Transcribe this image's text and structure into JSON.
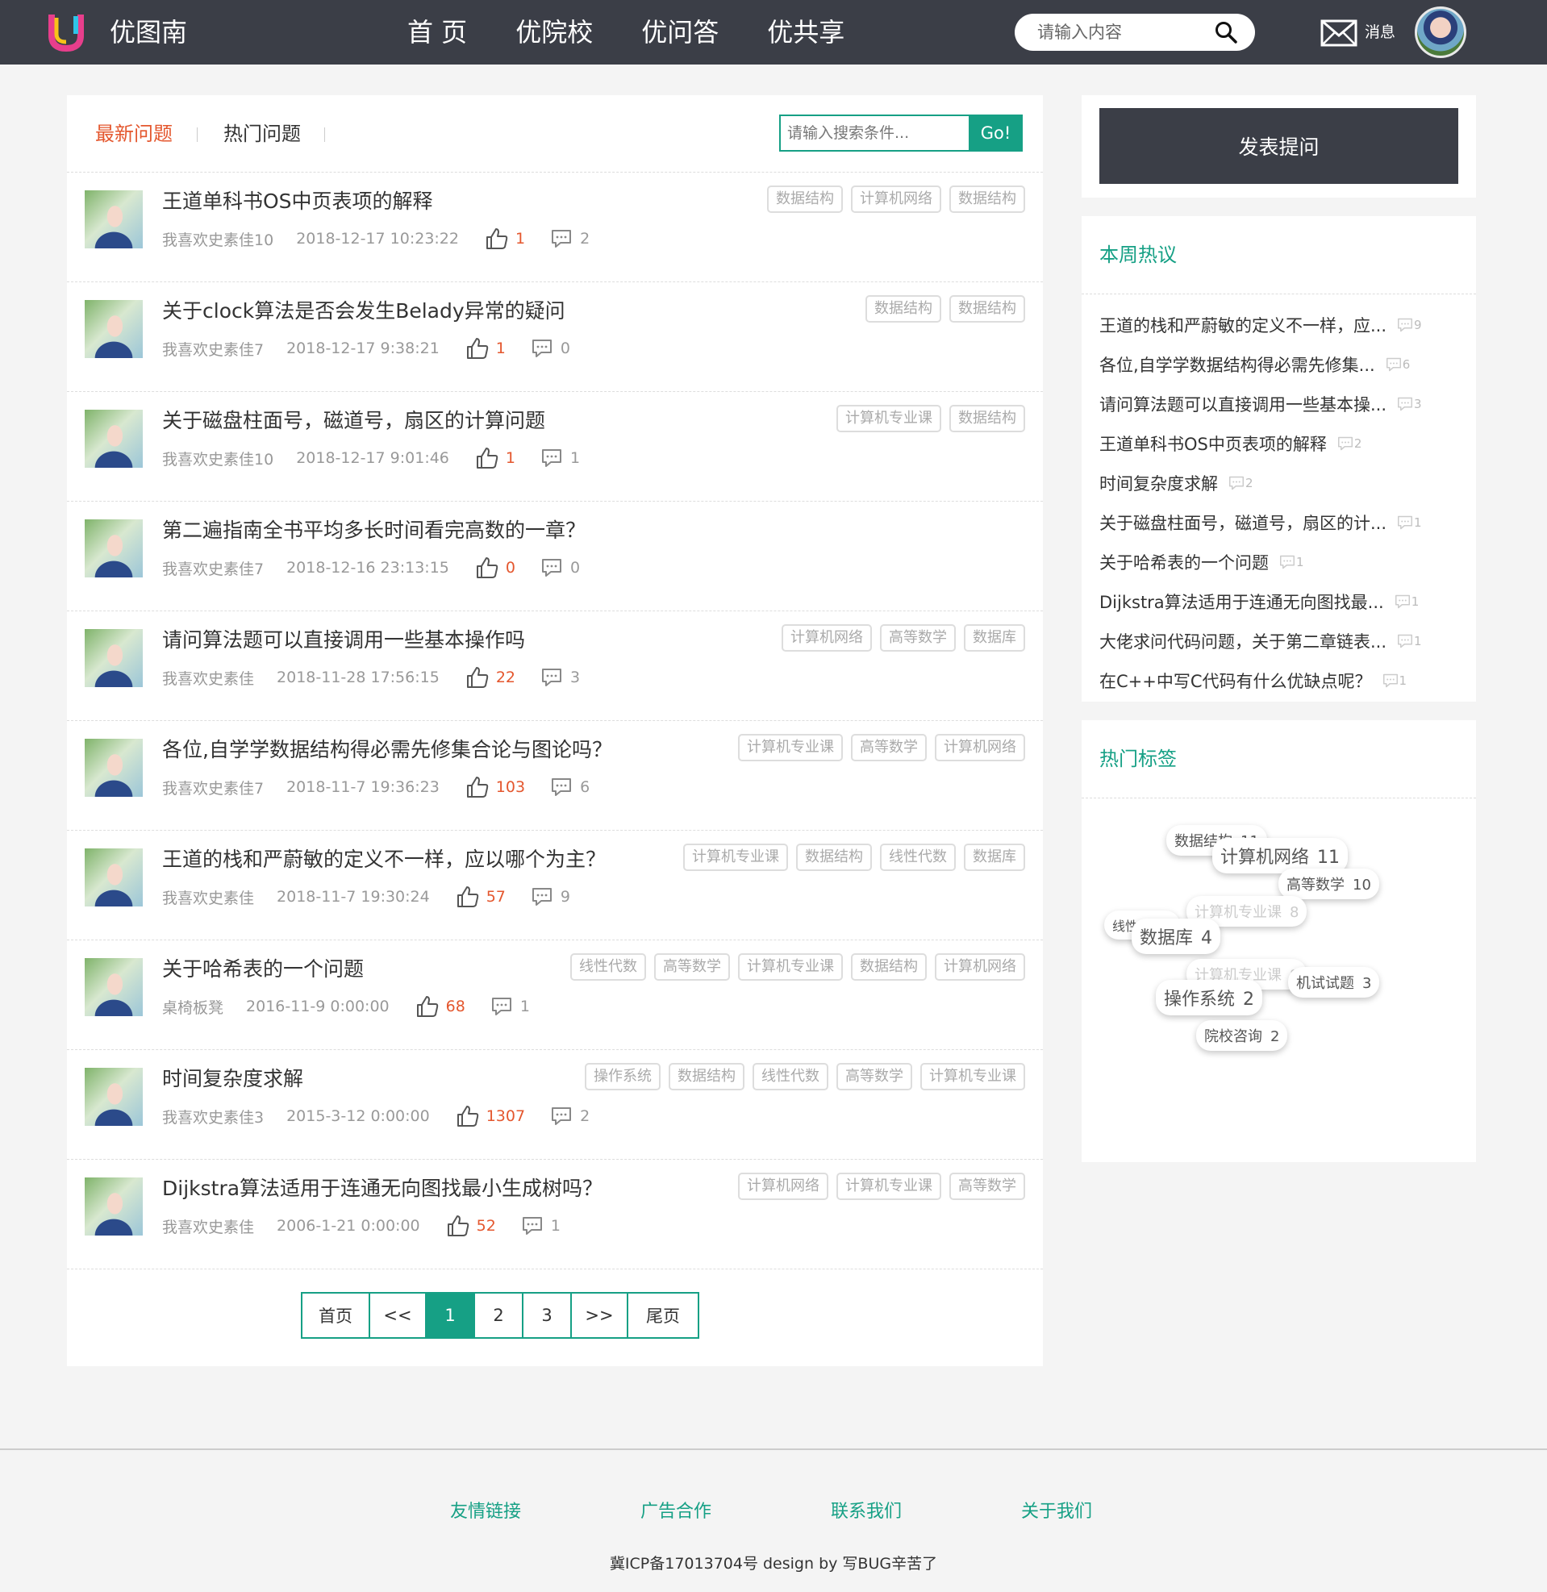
{
  "header": {
    "logo_text": "优图南",
    "nav": [
      "首 页",
      "优院校",
      "优问答",
      "优共享"
    ],
    "search_placeholder": "请输入内容",
    "message_label": "消息"
  },
  "tabs": {
    "latest": "最新问题",
    "hot": "热门问题"
  },
  "filter": {
    "placeholder": "请输入搜索条件...",
    "button": "Go!"
  },
  "questions": [
    {
      "title": "王道单科书OS中页表项的解释",
      "author": "我喜欢史素佳10",
      "date": "2018-12-17 10:23:22",
      "likes": "1",
      "comments": "2",
      "tags": [
        "数据结构",
        "计算机网络",
        "数据结构"
      ]
    },
    {
      "title": "关于clock算法是否会发生Belady异常的疑问",
      "author": "我喜欢史素佳7",
      "date": "2018-12-17 9:38:21",
      "likes": "1",
      "comments": "0",
      "tags": [
        "数据结构",
        "数据结构"
      ]
    },
    {
      "title": "关于磁盘柱面号，磁道号，扇区的计算问题",
      "author": "我喜欢史素佳10",
      "date": "2018-12-17 9:01:46",
      "likes": "1",
      "comments": "1",
      "tags": [
        "计算机专业课",
        "数据结构"
      ]
    },
    {
      "title": "第二遍指南全书平均多长时间看完高数的一章？",
      "author": "我喜欢史素佳7",
      "date": "2018-12-16 23:13:15",
      "likes": "0",
      "comments": "0",
      "tags": []
    },
    {
      "title": "请问算法题可以直接调用一些基本操作吗",
      "author": "我喜欢史素佳",
      "date": "2018-11-28 17:56:15",
      "likes": "22",
      "comments": "3",
      "tags": [
        "计算机网络",
        "高等数学",
        "数据库"
      ]
    },
    {
      "title": "各位,自学学数据结构得必需先修集合论与图论吗？",
      "author": "我喜欢史素佳7",
      "date": "2018-11-7 19:36:23",
      "likes": "103",
      "comments": "6",
      "tags": [
        "计算机专业课",
        "高等数学",
        "计算机网络"
      ]
    },
    {
      "title": "王道的栈和严蔚敏的定义不一样，应以哪个为主？",
      "author": "我喜欢史素佳",
      "date": "2018-11-7 19:30:24",
      "likes": "57",
      "comments": "9",
      "tags": [
        "计算机专业课",
        "数据结构",
        "线性代数",
        "数据库"
      ]
    },
    {
      "title": "关于哈希表的一个问题",
      "author": "桌椅板凳",
      "date": "2016-11-9 0:00:00",
      "likes": "68",
      "comments": "1",
      "tags": [
        "线性代数",
        "高等数学",
        "计算机专业课",
        "数据结构",
        "计算机网络"
      ]
    },
    {
      "title": "时间复杂度求解",
      "author": "我喜欢史素佳3",
      "date": "2015-3-12 0:00:00",
      "likes": "1307",
      "comments": "2",
      "tags": [
        "操作系统",
        "数据结构",
        "线性代数",
        "高等数学",
        "计算机专业课"
      ]
    },
    {
      "title": "Dijkstra算法适用于连通无向图找最小生成树吗？",
      "author": "我喜欢史素佳",
      "date": "2006-1-21 0:00:00",
      "likes": "52",
      "comments": "1",
      "tags": [
        "计算机网络",
        "计算机专业课",
        "高等数学"
      ]
    }
  ],
  "pagination": [
    "首页",
    "<<",
    "1",
    "2",
    "3",
    ">>",
    "尾页"
  ],
  "pagination_active": "1",
  "sidebar": {
    "ask_button": "发表提问",
    "hot_title": "本周热议",
    "hot_items": [
      {
        "text": "王道的栈和严蔚敏的定义不一样，应...",
        "count": "9"
      },
      {
        "text": "各位,自学学数据结构得必需先修集...",
        "count": "6"
      },
      {
        "text": "请问算法题可以直接调用一些基本操...",
        "count": "3"
      },
      {
        "text": "王道单科书OS中页表项的解释",
        "count": "2"
      },
      {
        "text": "时间复杂度求解",
        "count": "2"
      },
      {
        "text": "关于磁盘柱面号，磁道号，扇区的计...",
        "count": "1"
      },
      {
        "text": "关于哈希表的一个问题",
        "count": "1"
      },
      {
        "text": "Dijkstra算法适用于连通无向图找最...",
        "count": "1"
      },
      {
        "text": "大佬求问代码问题，关于第二章链表...",
        "count": "1"
      },
      {
        "text": "在C++中写C代码有什么优缺点呢？",
        "count": "1"
      }
    ],
    "tags_title": "热门标签",
    "tag_cloud": [
      {
        "name": "数据结构",
        "count": "11"
      },
      {
        "name": "计算机网络",
        "count": "11"
      },
      {
        "name": "高等数学",
        "count": "10"
      },
      {
        "name": "计算机专业课",
        "count": "8"
      },
      {
        "name": "线性代数",
        "count": ""
      },
      {
        "name": "数据库",
        "count": "4"
      },
      {
        "name": "计算机专业课",
        "count": "8"
      },
      {
        "name": "机试试题",
        "count": "3"
      },
      {
        "name": "操作系统",
        "count": "2"
      },
      {
        "name": "院校咨询",
        "count": "2"
      }
    ]
  },
  "footer": {
    "links": [
      "友情链接",
      "广告合作",
      "联系我们",
      "关于我们"
    ],
    "copyright": "冀ICP备17013704号 design by 写BUG辛苦了"
  },
  "colors": {
    "accent": "#16a085",
    "header_bg": "#3b3e47",
    "highlight": "#e4572e"
  }
}
